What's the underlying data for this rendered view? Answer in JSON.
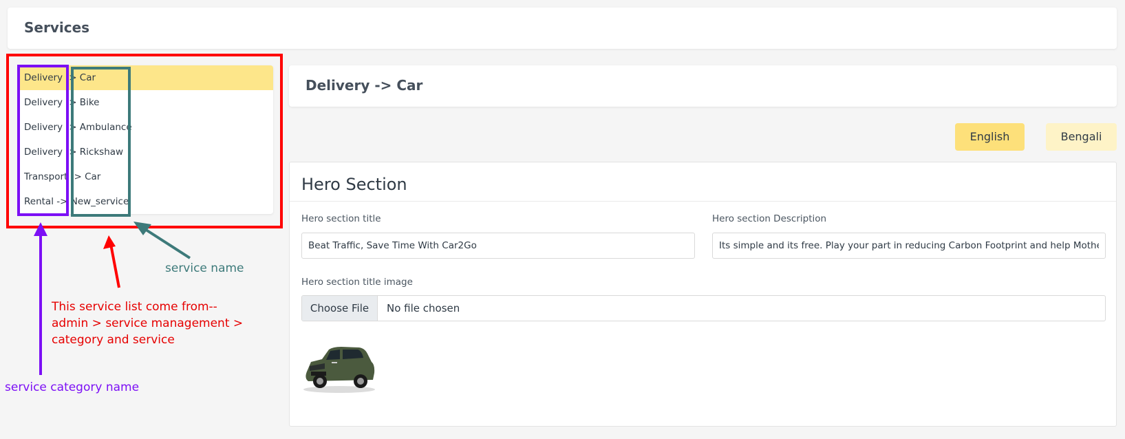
{
  "page": {
    "title": "Services"
  },
  "services": [
    {
      "label": "Delivery -> Car",
      "active": true
    },
    {
      "label": "Delivery -> Bike",
      "active": false
    },
    {
      "label": "Delivery -> Ambulance",
      "active": false
    },
    {
      "label": "Delivery -> Rickshaw",
      "active": false
    },
    {
      "label": "Transport -> Car",
      "active": false
    },
    {
      "label": "Rental -> New_service",
      "active": false
    }
  ],
  "annotations": {
    "service_name": "service name",
    "service_list_note": "This service list come from--\nadmin > service management >\ncategory and service",
    "service_category_name": "service category name"
  },
  "detail": {
    "title": "Delivery -> Car",
    "languages": [
      "English",
      "Bengali"
    ],
    "hero": {
      "section_title": "Hero Section",
      "title_label": "Hero section title",
      "title_value": "Beat Traffic, Save Time With Car2Go",
      "description_label": "Hero section Description",
      "description_value": "Its simple and its free. Play your part in reducing Carbon Footprint and help Mother Nature",
      "image_label": "Hero section title image",
      "file_button": "Choose File",
      "file_status": "No file chosen"
    }
  },
  "colors": {
    "active_item": "#fde68a",
    "lang_active": "#fde07a",
    "lang_inactive": "#fef3c7",
    "annotation_red": "#ff0000",
    "annotation_purple": "#7c0ff5",
    "annotation_teal": "#3d7a7a"
  },
  "icons": [
    "car-thumbnail-image"
  ]
}
